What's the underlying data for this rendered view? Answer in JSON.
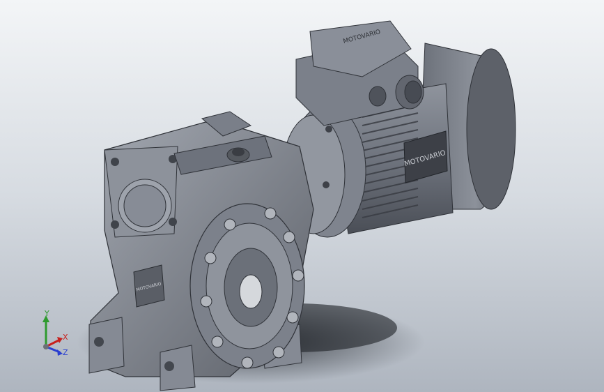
{
  "viewport": {
    "motor_nameplate_text": "MOTOVARIO",
    "terminal_box_text": "MOTOVARIO",
    "gearbox_nameplate_text": "MOTOVARIO"
  },
  "triad": {
    "y_label": "Y",
    "x_label": "X",
    "z_label": "Z",
    "colors": {
      "x": "#c8211d",
      "y": "#2e9a2e",
      "z": "#2a3fd0"
    }
  },
  "colors": {
    "background_top": "#f3f5f7",
    "background_bottom": "#aeb5bf",
    "metal_light": "#9ea3ad",
    "metal_mid": "#6e737d",
    "metal_dark": "#3f434b"
  }
}
